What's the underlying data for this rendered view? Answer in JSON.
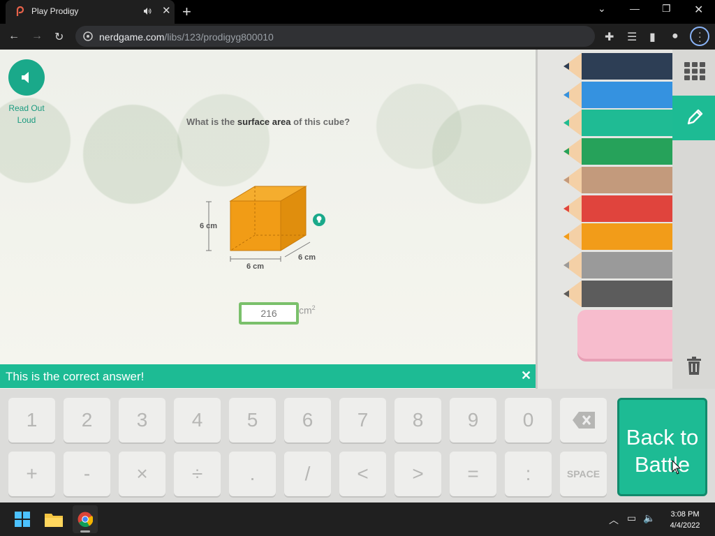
{
  "browser": {
    "tab_title": "Play Prodigy",
    "url_domain": "nerdgame.com",
    "url_path": "/libs/123/prodigyg800010"
  },
  "page": {
    "read_out_loud": "Read Out Loud",
    "question_pre": "What is the ",
    "question_bold": "surface area",
    "question_post": " of this cube?",
    "cube": {
      "height_label": "6 cm",
      "width_label": "6 cm",
      "depth_label": "6 cm",
      "color": "#f19c16"
    },
    "answer_value": "216",
    "answer_unit": "cm",
    "answer_unit_exp": "2",
    "feedback": "This is the correct answer!",
    "accent": "#1dbb94"
  },
  "draw_panel": {
    "pencil_colors": [
      "#2d3e55",
      "#3592e0",
      "#1fbb94",
      "#26a25a",
      "#c39a7c",
      "#e0443d",
      "#f29c19",
      "#9a9a9a",
      "#5c5c5c"
    ],
    "eraser_color": "#f7bccd",
    "tools": [
      "grid-icon",
      "pencil-icon",
      "trash-icon"
    ]
  },
  "keypad": {
    "row1": [
      "1",
      "2",
      "3",
      "4",
      "5",
      "6",
      "7",
      "8",
      "9",
      "0"
    ],
    "row2": [
      "+",
      "-",
      "×",
      "÷",
      ".",
      "/",
      "<",
      ">",
      "=",
      ":",
      "SPACE"
    ],
    "back_button": "Back to Battle"
  },
  "taskbar": {
    "time": "3:08 PM",
    "date": "4/4/2022"
  }
}
